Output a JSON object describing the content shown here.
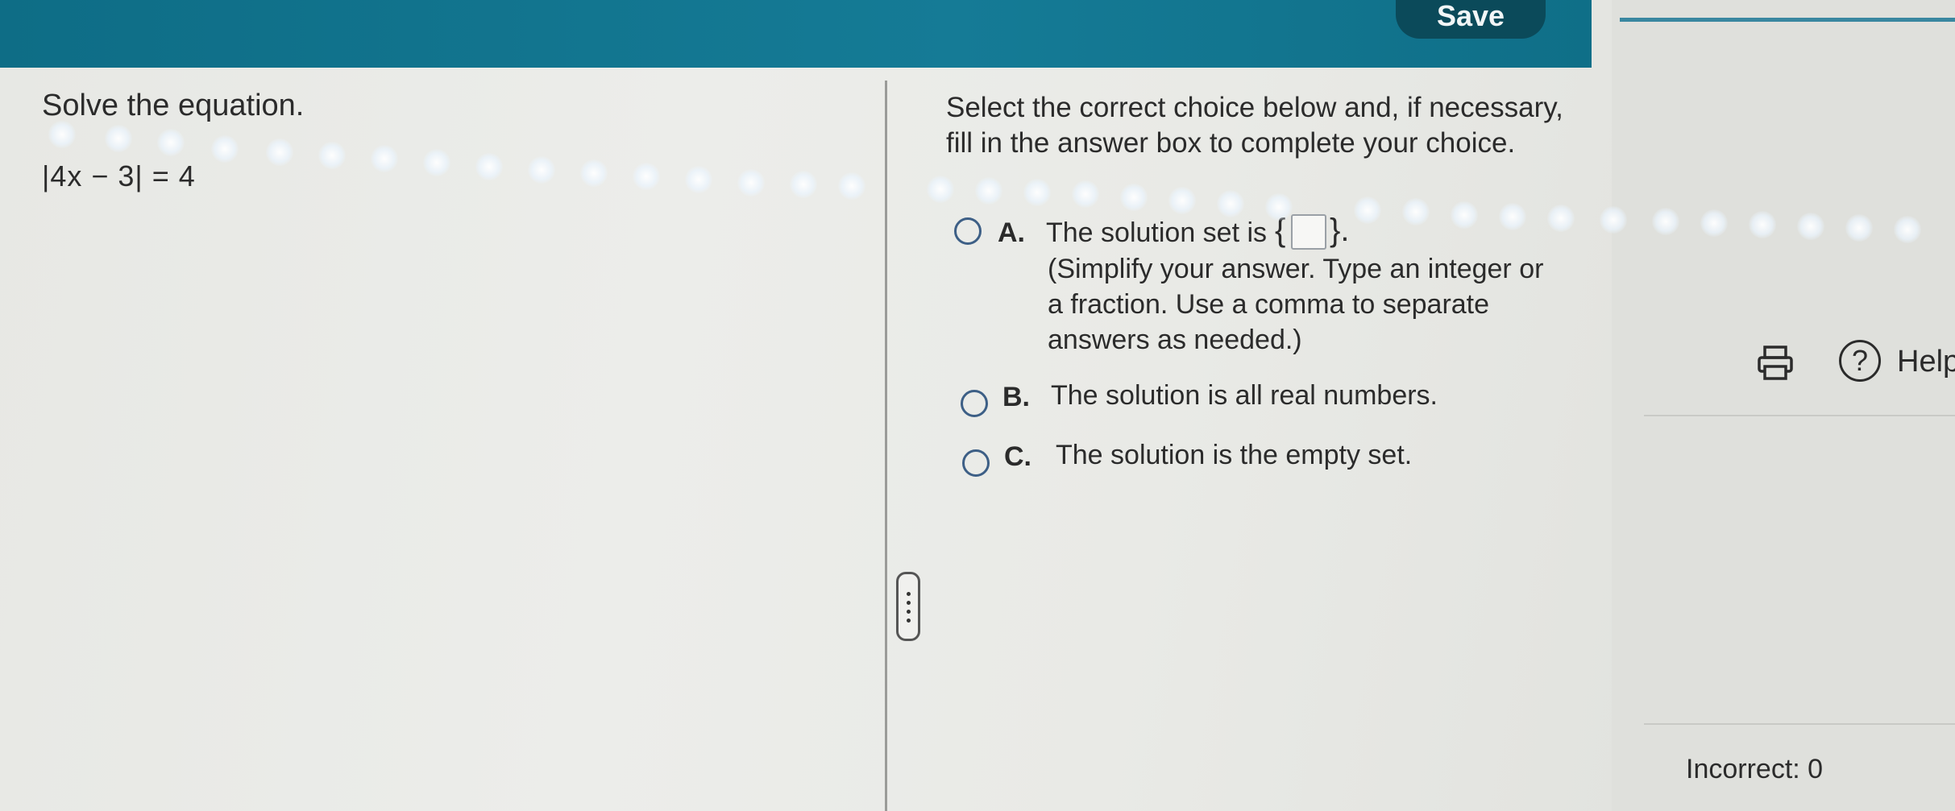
{
  "toolbar": {
    "save_label": "Save"
  },
  "question": {
    "prompt": "Solve the equation.",
    "equation": "|4x − 3| = 4"
  },
  "instructions": "Select the correct choice below and, if necessary, fill in the answer box to complete your choice.",
  "choices": [
    {
      "letter": "A.",
      "text_before": "The solution set is",
      "open_brace": "{",
      "close_brace": "}.",
      "note": "(Simplify your answer. Type an integer or a fraction. Use a comma to separate answers as needed.)",
      "answer_value": ""
    },
    {
      "letter": "B.",
      "text": "The solution is all real numbers."
    },
    {
      "letter": "C.",
      "text": "The solution is the empty set."
    }
  ],
  "side_panel": {
    "help_symbol": "?",
    "help_label": "Help",
    "incorrect_label": "Incorrect: 0"
  },
  "icons": [
    "print-icon",
    "help-icon",
    "drag-handle-icon"
  ],
  "colors": {
    "header": "#157b96",
    "save_button": "#0b4a5a",
    "radio_border": "#3d5f86"
  }
}
